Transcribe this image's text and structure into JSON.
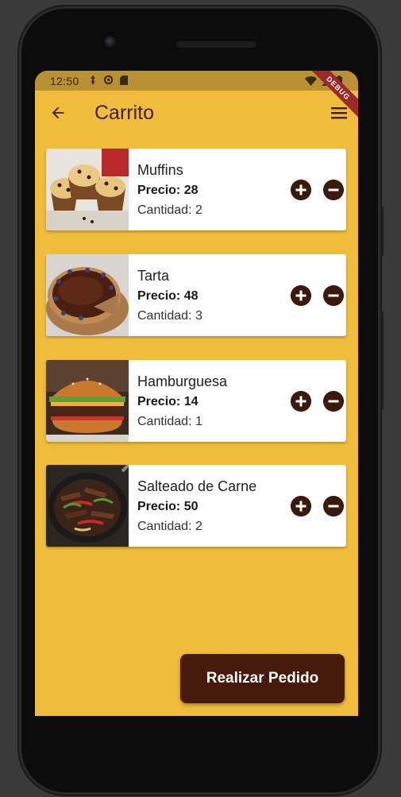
{
  "status_bar": {
    "time": "12:50"
  },
  "debug_banner": "DEBUG",
  "app_bar": {
    "title": "Carrito"
  },
  "cart": {
    "items": [
      {
        "name": "Muffins",
        "price": "Precio: 28",
        "quantity": "Cantidad: 2"
      },
      {
        "name": "Tarta",
        "price": "Precio: 48",
        "quantity": "Cantidad: 3"
      },
      {
        "name": "Hamburguesa",
        "price": "Precio: 14",
        "quantity": "Cantidad: 1"
      },
      {
        "name": "Salteado de Carne",
        "price": "Precio: 50",
        "quantity": "Cantidad: 2"
      }
    ]
  },
  "order_button": {
    "label": "Realizar Pedido"
  },
  "colors": {
    "background": "#F0BC3C",
    "status_bar": "#B99033",
    "accent": "#461B0B"
  },
  "icons": {
    "back": "arrow-back-icon",
    "menu": "menu-icon",
    "add": "plus-circle-icon",
    "remove": "minus-circle-icon"
  }
}
